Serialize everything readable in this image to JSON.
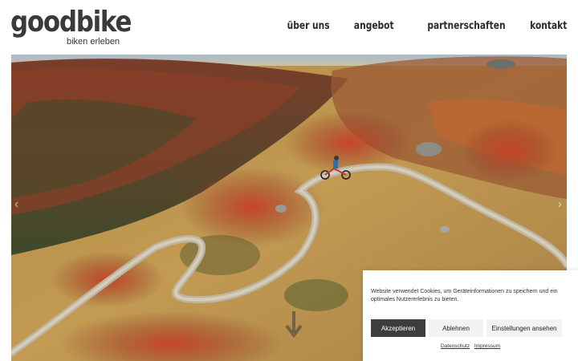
{
  "brand": {
    "name": "goodbike",
    "tagline": "biken erleben"
  },
  "nav": {
    "items": [
      "über uns",
      "angebot",
      "partnerschaften",
      "kontakt"
    ]
  },
  "hero": {
    "prev_icon": "chevron-left-icon",
    "next_icon": "chevron-right-icon",
    "scroll_icon": "scroll-down-icon"
  },
  "cookie": {
    "text": "Website verwendet Cookies, um Geräteinformationen zu speichern und ein optimales Nutzererlebnis zu bieten.",
    "accept_label": "Akzeptieren",
    "deny_label": "Ablehnen",
    "settings_label": "Einstellungen ansehen",
    "privacy_link": "Datenschutz",
    "imprint_link": "Impressum"
  },
  "colors": {
    "brand_text": "#3a3a3a",
    "accept_button": "#3d3d3d",
    "secondary_button": "#f2f2f2"
  }
}
